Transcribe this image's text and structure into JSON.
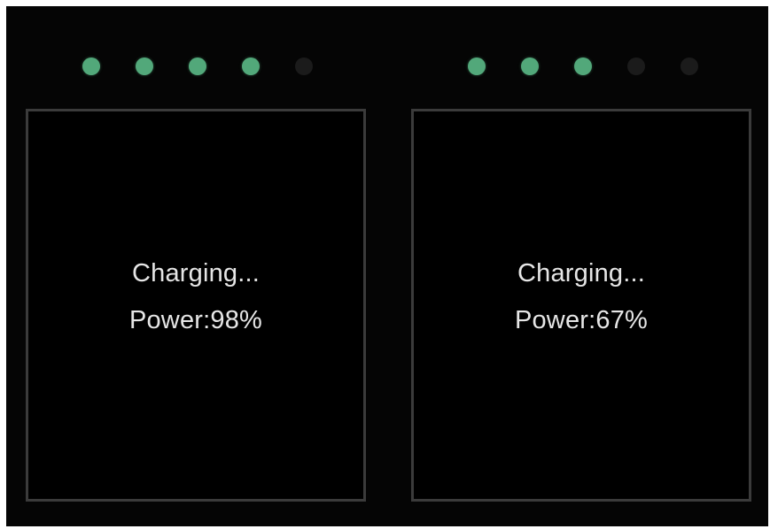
{
  "chargers": [
    {
      "status": "Charging...",
      "power_label": "Power:98%",
      "power_percent": 98,
      "leds": [
        true,
        true,
        true,
        true,
        false
      ]
    },
    {
      "status": "Charging...",
      "power_label": "Power:67%",
      "power_percent": 67,
      "leds": [
        true,
        true,
        true,
        false,
        false
      ]
    }
  ],
  "colors": {
    "led_on": "#52a87a",
    "led_off": "#1b1b1b",
    "background": "#050505",
    "box_border": "#3b3b3b",
    "text": "#e6e6e6"
  }
}
